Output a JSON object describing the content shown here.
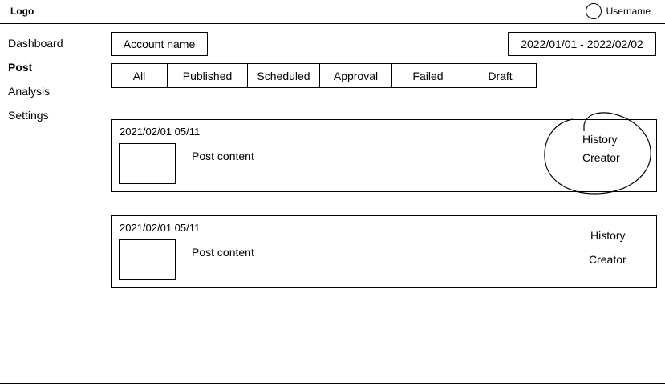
{
  "header": {
    "logo": "Logo",
    "username": "Username"
  },
  "sidebar": {
    "items": [
      {
        "label": "Dashboard",
        "active": false
      },
      {
        "label": "Post",
        "active": true
      },
      {
        "label": "Analysis",
        "active": false
      },
      {
        "label": "Settings",
        "active": false
      }
    ]
  },
  "filters": {
    "account": "Account name",
    "date_range": "2022/01/01 - 2022/02/02"
  },
  "tabs": [
    "All",
    "Published",
    "Scheduled",
    "Approval",
    "Failed",
    "Draft"
  ],
  "posts": [
    {
      "date": "2021/02/01 05/11",
      "content": "Post content",
      "history": "History",
      "creator": "Creator"
    },
    {
      "date": "2021/02/01 05/11",
      "content": "Post content",
      "history": "History",
      "creator": "Creator"
    }
  ]
}
